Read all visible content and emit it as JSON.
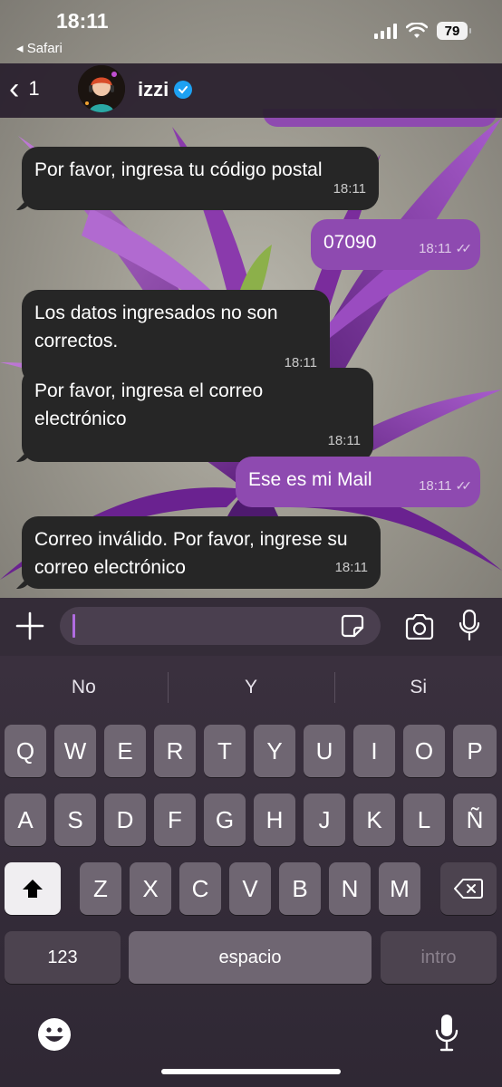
{
  "status_bar": {
    "time": "18:11",
    "back_app": "◂ Safari",
    "battery": "79"
  },
  "header": {
    "back_count": "1",
    "contact_name": "izzi",
    "verified": true
  },
  "messages": [
    {
      "direction": "in",
      "text": "Por favor, ingresa tu código postal",
      "time": "18:11"
    },
    {
      "direction": "out",
      "text": "07090",
      "time": "18:11",
      "status": "read"
    },
    {
      "direction": "in",
      "text": "Los datos ingresados no son correctos.",
      "time": "18:11"
    },
    {
      "direction": "in",
      "text": "Por favor, ingresa el correo electrónico",
      "time": "18:11"
    },
    {
      "direction": "out",
      "text": "Ese es mi Mail",
      "time": "18:11",
      "status": "read"
    },
    {
      "direction": "in",
      "text": "Correo inválido. Por favor, ingrese su correo electrónico",
      "time": "18:11"
    }
  ],
  "input": {
    "value": ""
  },
  "keyboard": {
    "suggestions": [
      "No",
      "Y",
      "Si"
    ],
    "row1": [
      "Q",
      "W",
      "E",
      "R",
      "T",
      "Y",
      "U",
      "I",
      "O",
      "P"
    ],
    "row2": [
      "A",
      "S",
      "D",
      "F",
      "G",
      "H",
      "J",
      "K",
      "L",
      "Ñ"
    ],
    "row3": [
      "Z",
      "X",
      "C",
      "V",
      "B",
      "N",
      "M"
    ],
    "numbers_key": "123",
    "space_key": "espacio",
    "return_key": "intro"
  },
  "colors": {
    "incoming_bubble": "#262626",
    "outgoing_bubble": "#8e4ab0",
    "caret": "#b06ce0",
    "verified_badge": "#1da1f2"
  }
}
